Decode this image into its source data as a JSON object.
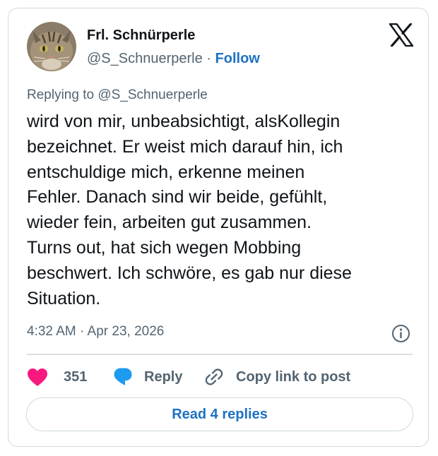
{
  "author": {
    "name": "Frl. Schnürperle",
    "handle": "@S_Schnuerperle",
    "separator": "·",
    "follow_label": "Follow"
  },
  "reply_context": "Replying to @S_Schnuerperle",
  "tweet_lines": [
    "wird von mir, unbeabsichtigt, alsKollegin",
    "bezeichnet. Er weist mich darauf hin, ich",
    "entschuldige mich, erkenne meinen",
    "Fehler. Danach sind wir beide, gefühlt,",
    "wieder fein, arbeiten gut zusammen.",
    "Turns out, hat sich wegen Mobbing",
    "beschwert. Ich schwöre, es gab nur diese",
    "Situation."
  ],
  "timestamp": "4:32 AM · Apr 23, 2026",
  "actions": {
    "like_count": "351",
    "reply_label": "Reply",
    "copy_label": "Copy link to post"
  },
  "read_replies_label": "Read 4 replies",
  "colors": {
    "accent": "#1d72c3",
    "like": "#f91880",
    "reply_icon": "#1d9bf0",
    "muted": "#536471",
    "text": "#0f1419",
    "border": "#cfd9de"
  },
  "icons": {
    "brand": "x-logo-icon",
    "info": "info-icon",
    "like": "heart-icon",
    "reply": "speech-bubble-icon",
    "copy": "link-icon"
  }
}
